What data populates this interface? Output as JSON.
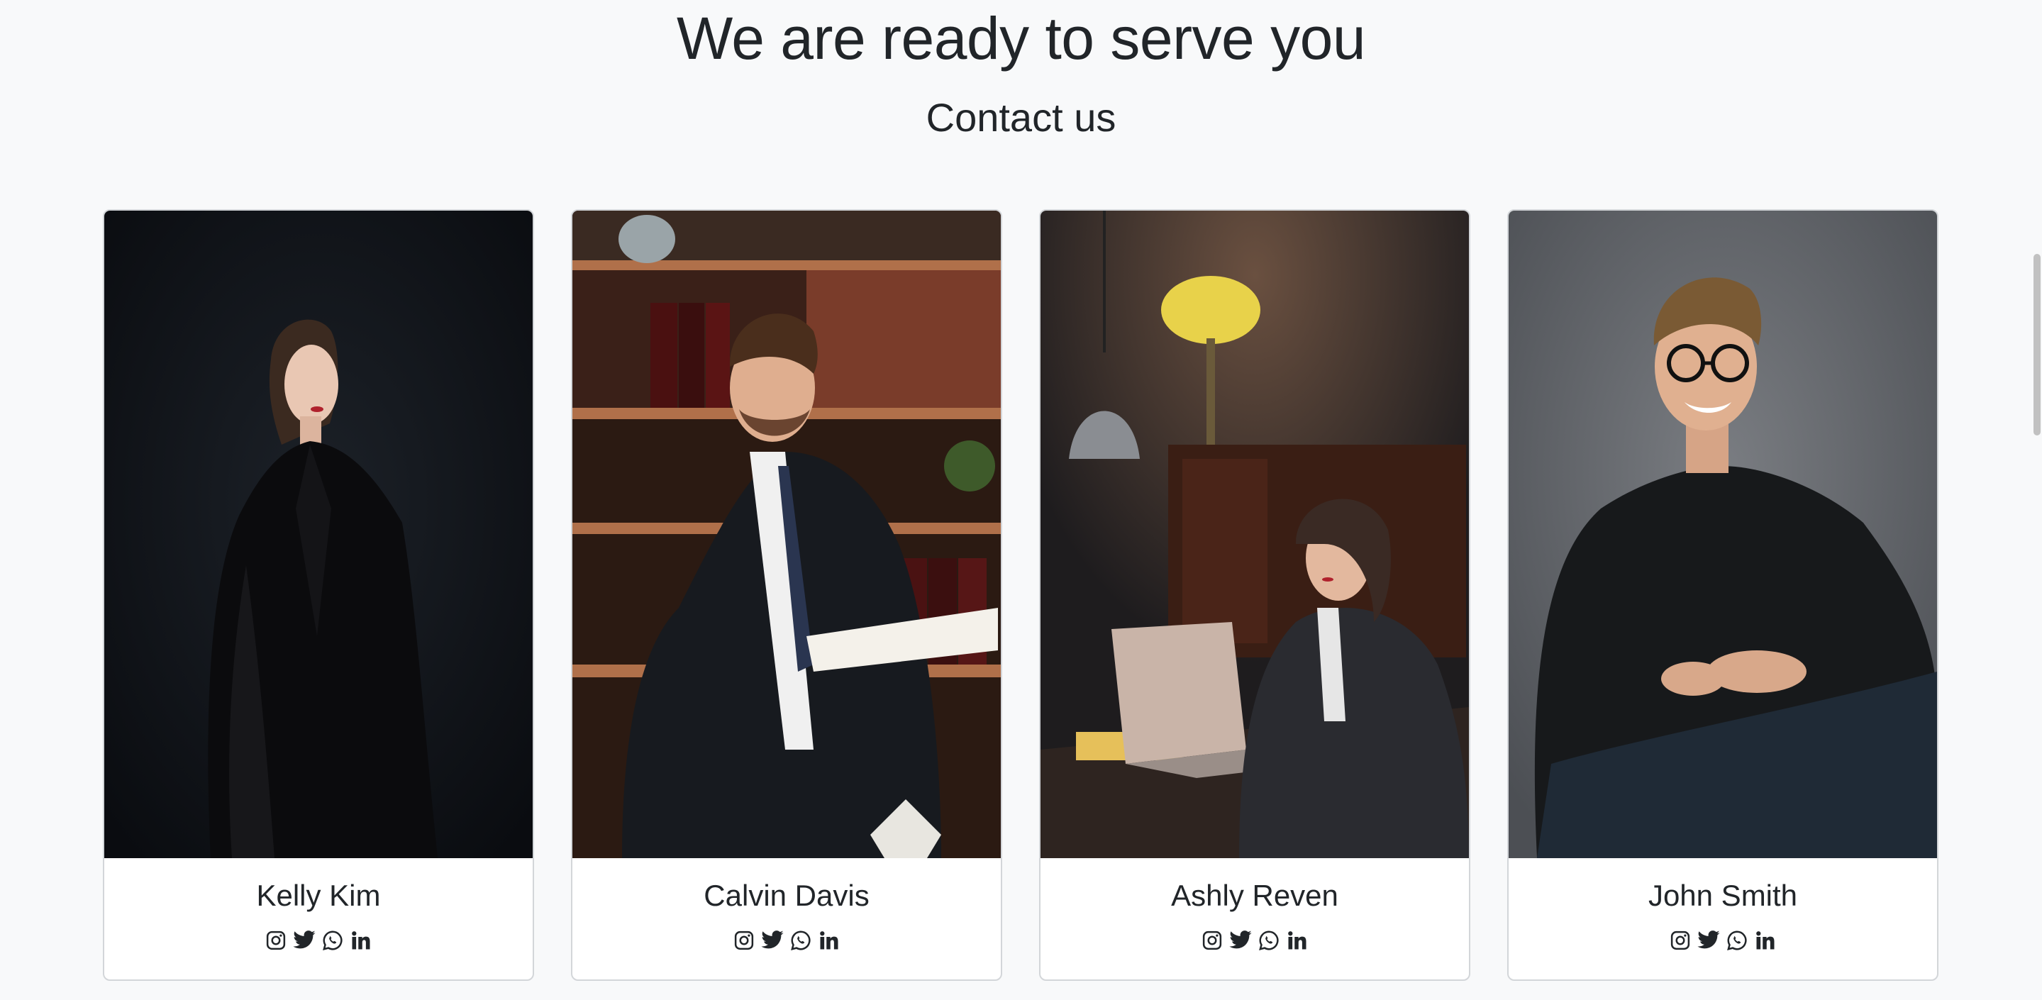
{
  "header": {
    "title": "We are ready to serve you",
    "subtitle": "Contact us"
  },
  "team": [
    {
      "name": "Kelly Kim",
      "photo": "woman-in-black-suit-portrait"
    },
    {
      "name": "Calvin Davis",
      "photo": "man-in-suit-holding-book"
    },
    {
      "name": "Ashly Reven",
      "photo": "woman-working-on-laptop"
    },
    {
      "name": "John Smith",
      "photo": "smiling-man-with-glasses"
    }
  ],
  "social_icons": [
    "instagram-icon",
    "twitter-icon",
    "whatsapp-icon",
    "linkedin-icon"
  ],
  "colors": {
    "background": "#f8f9fa",
    "text": "#212529",
    "card_border": "#d3d6d9"
  }
}
